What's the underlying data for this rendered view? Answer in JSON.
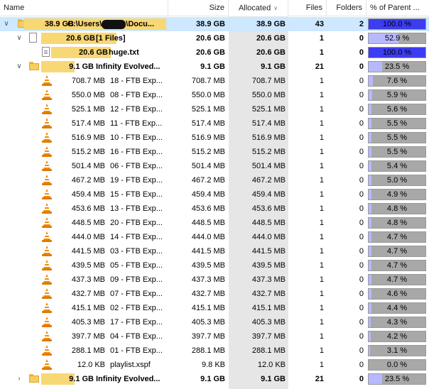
{
  "header": {
    "name": "Name",
    "size": "Size",
    "allocated": "Allocated",
    "files": "Files",
    "folders": "Folders",
    "percent": "% of Parent ..."
  },
  "colors": {
    "pct_fill_full": "#3c3cf0",
    "pct_fill_partial": "#b8b8ff",
    "selected_row": "#cde8ff",
    "name_bar": "#f8d775"
  },
  "rows": [
    {
      "icon": "folder-icon",
      "expander": "expanded",
      "size_label": "38.9 GB",
      "name": "C:\\Users\\",
      "name_tail": "\\Docu...",
      "size": "38.9 GB",
      "allocated": "38.9 GB",
      "files": "43",
      "folders": "2",
      "percent": "100.0 %",
      "fraction": 1.0,
      "selected": true
    },
    {
      "icon": "file-icon",
      "expander": "expanded",
      "size_label": "20.6 GB",
      "name": "[1 Files]",
      "size": "20.6 GB",
      "allocated": "20.6 GB",
      "files": "1",
      "folders": "0",
      "percent": "52.9 %",
      "fraction": 0.529
    },
    {
      "icon": "txt-icon",
      "expander": "none",
      "size_label": "20.6 GB",
      "name": "huge.txt",
      "size": "20.6 GB",
      "allocated": "20.6 GB",
      "files": "1",
      "folders": "0",
      "percent": "100.0 %",
      "fraction": 1.0
    },
    {
      "icon": "folder-icon",
      "expander": "expanded",
      "size_label": "9.1 GB",
      "name": "Infinity Evolved...",
      "size": "9.1 GB",
      "allocated": "9.1 GB",
      "files": "21",
      "folders": "0",
      "percent": "23.5 %",
      "fraction": 0.235
    },
    {
      "icon": "vlc-icon",
      "size_label": "708.7 MB",
      "name": "18 - FTB Exp...",
      "size": "708.7 MB",
      "allocated": "708.7 MB",
      "files": "1",
      "folders": "0",
      "percent": "7.6 %",
      "fraction": 0.076
    },
    {
      "icon": "vlc-icon",
      "size_label": "550.0 MB",
      "name": "08 - FTB Exp...",
      "size": "550.0 MB",
      "allocated": "550.0 MB",
      "files": "1",
      "folders": "0",
      "percent": "5.9 %",
      "fraction": 0.059
    },
    {
      "icon": "vlc-icon",
      "size_label": "525.1 MB",
      "name": "12 - FTB Exp...",
      "size": "525.1 MB",
      "allocated": "525.1 MB",
      "files": "1",
      "folders": "0",
      "percent": "5.6 %",
      "fraction": 0.056
    },
    {
      "icon": "vlc-icon",
      "size_label": "517.4 MB",
      "name": "11 - FTB Exp...",
      "size": "517.4 MB",
      "allocated": "517.4 MB",
      "files": "1",
      "folders": "0",
      "percent": "5.5 %",
      "fraction": 0.055
    },
    {
      "icon": "vlc-icon",
      "size_label": "516.9 MB",
      "name": "10 - FTB Exp...",
      "size": "516.9 MB",
      "allocated": "516.9 MB",
      "files": "1",
      "folders": "0",
      "percent": "5.5 %",
      "fraction": 0.055
    },
    {
      "icon": "vlc-icon",
      "size_label": "515.2 MB",
      "name": "16 - FTB Exp...",
      "size": "515.2 MB",
      "allocated": "515.2 MB",
      "files": "1",
      "folders": "0",
      "percent": "5.5 %",
      "fraction": 0.055
    },
    {
      "icon": "vlc-icon",
      "size_label": "501.4 MB",
      "name": "06 - FTB Exp...",
      "size": "501.4 MB",
      "allocated": "501.4 MB",
      "files": "1",
      "folders": "0",
      "percent": "5.4 %",
      "fraction": 0.054
    },
    {
      "icon": "vlc-icon",
      "size_label": "467.2 MB",
      "name": "19 - FTB Exp...",
      "size": "467.2 MB",
      "allocated": "467.2 MB",
      "files": "1",
      "folders": "0",
      "percent": "5.0 %",
      "fraction": 0.05
    },
    {
      "icon": "vlc-icon",
      "size_label": "459.4 MB",
      "name": "15 - FTB Exp...",
      "size": "459.4 MB",
      "allocated": "459.4 MB",
      "files": "1",
      "folders": "0",
      "percent": "4.9 %",
      "fraction": 0.049
    },
    {
      "icon": "vlc-icon",
      "size_label": "453.6 MB",
      "name": "13 - FTB Exp...",
      "size": "453.6 MB",
      "allocated": "453.6 MB",
      "files": "1",
      "folders": "0",
      "percent": "4.8 %",
      "fraction": 0.048
    },
    {
      "icon": "vlc-icon",
      "size_label": "448.5 MB",
      "name": "20 - FTB Exp...",
      "size": "448.5 MB",
      "allocated": "448.5 MB",
      "files": "1",
      "folders": "0",
      "percent": "4.8 %",
      "fraction": 0.048
    },
    {
      "icon": "vlc-icon",
      "size_label": "444.0 MB",
      "name": "14 - FTB Exp...",
      "size": "444.0 MB",
      "allocated": "444.0 MB",
      "files": "1",
      "folders": "0",
      "percent": "4.7 %",
      "fraction": 0.047
    },
    {
      "icon": "vlc-icon",
      "size_label": "441.5 MB",
      "name": "03 - FTB Exp...",
      "size": "441.5 MB",
      "allocated": "441.5 MB",
      "files": "1",
      "folders": "0",
      "percent": "4.7 %",
      "fraction": 0.047
    },
    {
      "icon": "vlc-icon",
      "size_label": "439.5 MB",
      "name": "05 - FTB Exp...",
      "size": "439.5 MB",
      "allocated": "439.5 MB",
      "files": "1",
      "folders": "0",
      "percent": "4.7 %",
      "fraction": 0.047
    },
    {
      "icon": "vlc-icon",
      "size_label": "437.3 MB",
      "name": "09 - FTB Exp...",
      "size": "437.3 MB",
      "allocated": "437.3 MB",
      "files": "1",
      "folders": "0",
      "percent": "4.7 %",
      "fraction": 0.047
    },
    {
      "icon": "vlc-icon",
      "size_label": "432.7 MB",
      "name": "07 - FTB Exp...",
      "size": "432.7 MB",
      "allocated": "432.7 MB",
      "files": "1",
      "folders": "0",
      "percent": "4.6 %",
      "fraction": 0.046
    },
    {
      "icon": "vlc-icon",
      "size_label": "415.1 MB",
      "name": "02 - FTB Exp...",
      "size": "415.1 MB",
      "allocated": "415.1 MB",
      "files": "1",
      "folders": "0",
      "percent": "4.4 %",
      "fraction": 0.044
    },
    {
      "icon": "vlc-icon",
      "size_label": "405.3 MB",
      "name": "17 - FTB Exp...",
      "size": "405.3 MB",
      "allocated": "405.3 MB",
      "files": "1",
      "folders": "0",
      "percent": "4.3 %",
      "fraction": 0.043
    },
    {
      "icon": "vlc-icon",
      "size_label": "397.7 MB",
      "name": "04 - FTB Exp...",
      "size": "397.7 MB",
      "allocated": "397.7 MB",
      "files": "1",
      "folders": "0",
      "percent": "4.2 %",
      "fraction": 0.042
    },
    {
      "icon": "vlc-icon",
      "size_label": "288.1 MB",
      "name": "01 - FTB Exp...",
      "size": "288.1 MB",
      "allocated": "288.1 MB",
      "files": "1",
      "folders": "0",
      "percent": "3.1 %",
      "fraction": 0.031
    },
    {
      "icon": "vlc-icon",
      "size_label": "12.0 KB",
      "name": "playlist.xspf",
      "size": "9.8 KB",
      "allocated": "12.0 KB",
      "files": "1",
      "folders": "0",
      "percent": "0.0 %",
      "fraction": 0.0
    },
    {
      "icon": "folder-icon",
      "expander": "collapsed",
      "size_label": "9.1 GB",
      "name": "Infinity Evolved...",
      "size": "9.1 GB",
      "allocated": "9.1 GB",
      "files": "21",
      "folders": "0",
      "percent": "23.5 %",
      "fraction": 0.235
    }
  ]
}
